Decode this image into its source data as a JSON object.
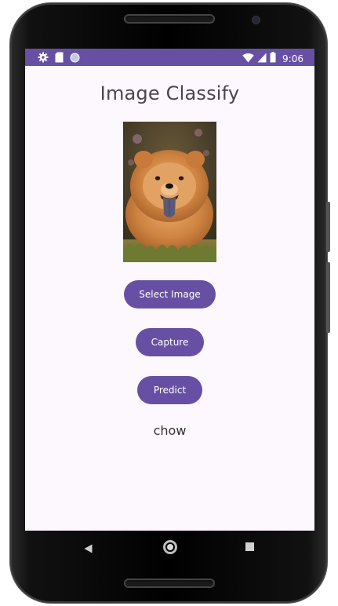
{
  "status_bar": {
    "time": "9:06",
    "left_icons": [
      "gear-icon",
      "sd-card-icon",
      "circle-icon"
    ],
    "right_icons": [
      "wifi-icon",
      "signal-icon",
      "battery-icon"
    ],
    "color": "#6750a4"
  },
  "app": {
    "title": "Image Classify",
    "image_description_icon": "dog-photo",
    "buttons": {
      "select_image": "Select Image",
      "capture": "Capture",
      "predict": "Predict"
    },
    "result": "chow",
    "accent": "#6750a4",
    "background": "#fdf8fd"
  },
  "nav_bar": {
    "icons": [
      "back-icon",
      "home-icon",
      "recent-apps-icon"
    ]
  }
}
